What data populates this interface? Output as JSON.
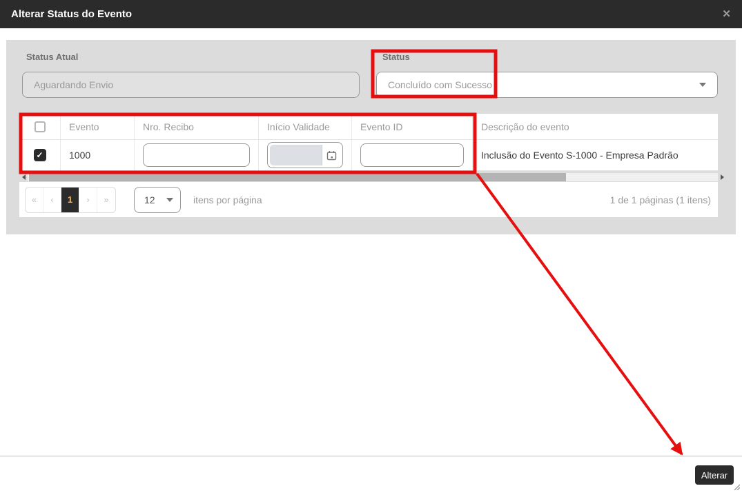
{
  "modal": {
    "title": "Alterar Status do Evento",
    "close_icon": "✕"
  },
  "form": {
    "status_atual": {
      "label": "Status Atual",
      "value": "Aguardando Envio"
    },
    "status": {
      "label": "Status",
      "value": "Concluído com Sucesso"
    }
  },
  "table": {
    "headers": {
      "evento": "Evento",
      "nro_recibo": "Nro. Recibo",
      "inicio_validade": "Início Validade",
      "evento_id": "Evento ID",
      "descricao": "Descrição do evento"
    },
    "row": {
      "selected": true,
      "evento": "1000",
      "nro_recibo": "",
      "inicio_validade": "",
      "evento_id": "",
      "descricao": "Inclusão do Evento S-1000 - Empresa Padrão"
    },
    "check_glyph": "✓"
  },
  "pagination": {
    "first": "«",
    "prev": "‹",
    "page": "1",
    "next": "›",
    "last": "»",
    "page_size": "12",
    "items_per_page_label": "itens por página",
    "summary": "1 de 1 páginas (1 itens)"
  },
  "footer": {
    "alterar_label": "Alterar"
  },
  "colors": {
    "accent_dark": "#2b2b2b",
    "annotation_red": "#e60f0f",
    "current_page_number": "#ffb84d",
    "panel_gray": "#dcdcdc"
  }
}
